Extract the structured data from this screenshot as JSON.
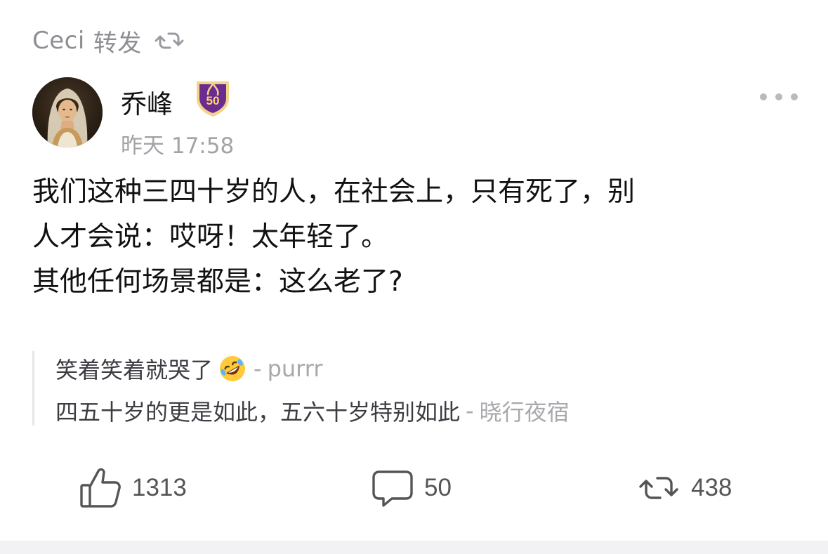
{
  "repost": {
    "user": "Ceci",
    "action": "转发",
    "icon": "repost-icon"
  },
  "author": {
    "name": "乔峰",
    "level": "50",
    "time": "昨天 17:58",
    "badge_color": "#6a2c8f"
  },
  "post": {
    "lines": [
      "我们这种三四十岁的人，在社会上，只有死了，别",
      "人才会说：哎呀！太年轻了。",
      "其他任何场景都是：这么老了?"
    ]
  },
  "comments": [
    {
      "text": "笑着笑着就哭了",
      "emoji": "rolling-on-floor-laughing-emoji",
      "separator": "-",
      "author": "purrr"
    },
    {
      "text": "四五十岁的更是如此，五六十岁特别如此",
      "separator": "-",
      "author": "晓行夜宿"
    }
  ],
  "actions": {
    "like": {
      "icon": "thumbs-up-icon",
      "count": "1313"
    },
    "comment": {
      "icon": "comment-bubble-icon",
      "count": "50"
    },
    "repost": {
      "icon": "repost-icon",
      "count": "438"
    }
  },
  "colors": {
    "text": "#111111",
    "muted": "#8e8e93",
    "divider": "#e6e6e9"
  }
}
